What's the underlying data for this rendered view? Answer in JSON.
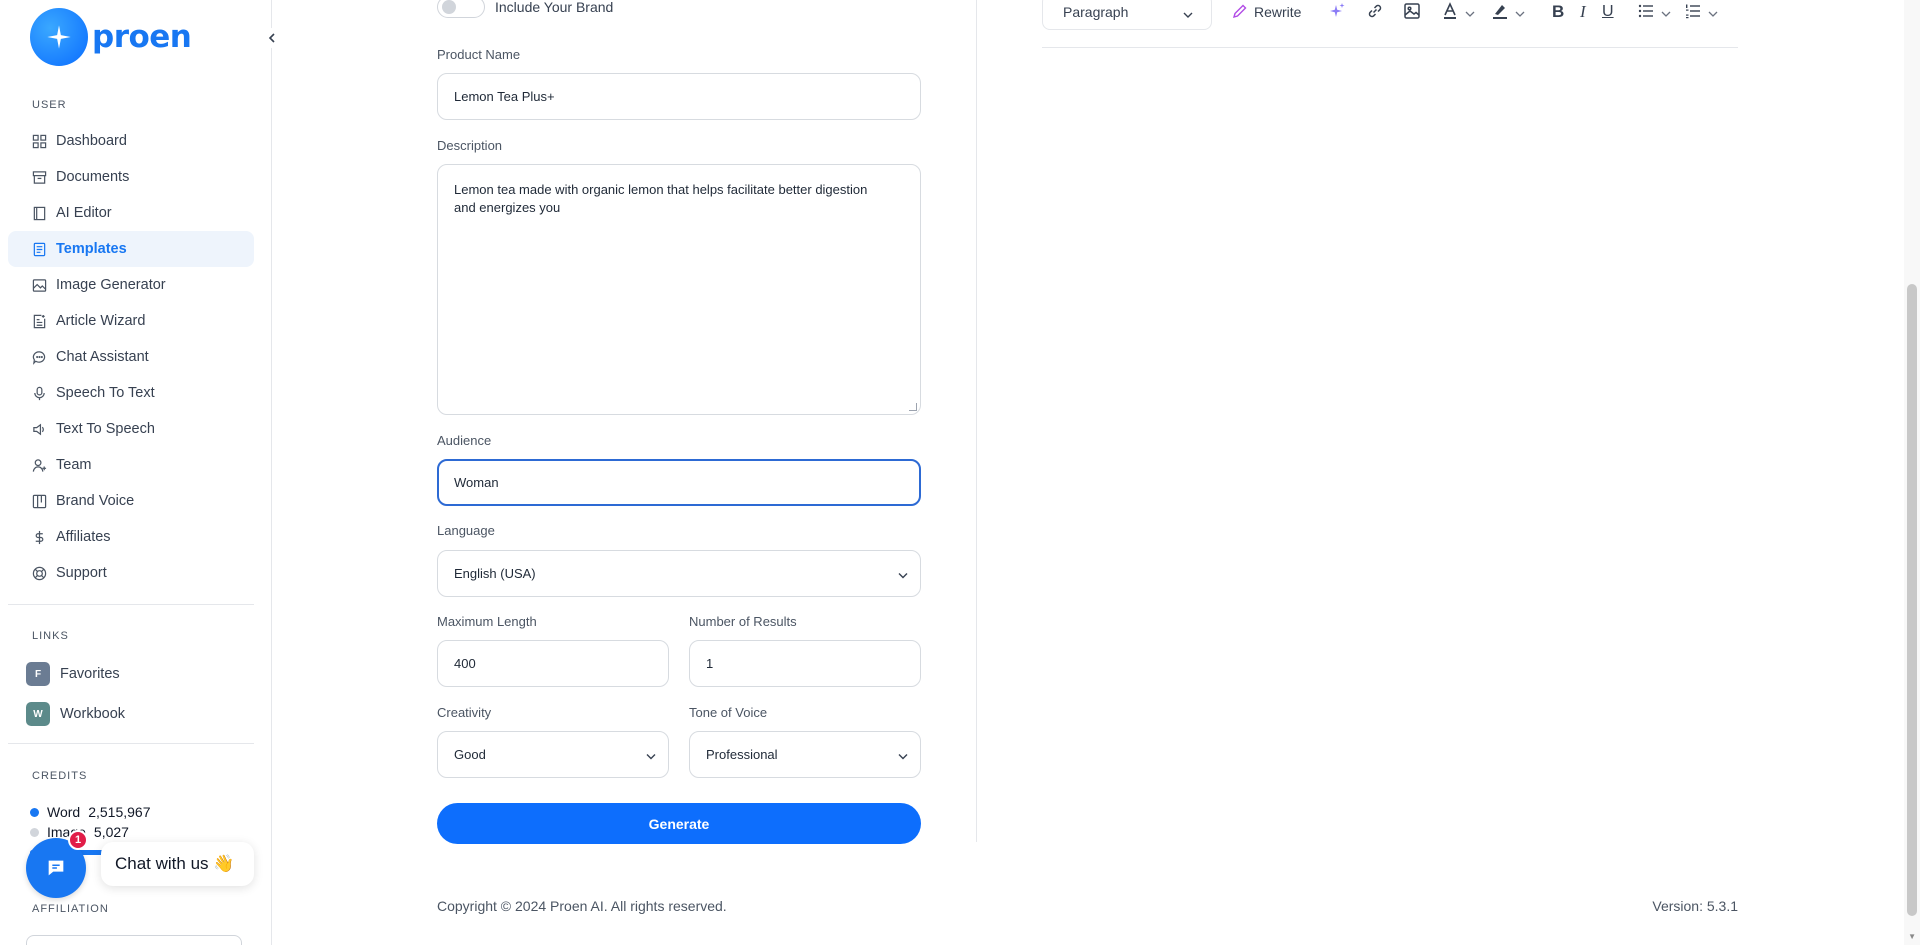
{
  "app": {
    "brand": "proen"
  },
  "sidebar": {
    "user_section": "USER",
    "items": [
      {
        "label": "Dashboard",
        "icon": "grid-icon"
      },
      {
        "label": "Documents",
        "icon": "archive-icon"
      },
      {
        "label": "AI Editor",
        "icon": "book-icon"
      },
      {
        "label": "Templates",
        "icon": "file-text-icon",
        "active": true
      },
      {
        "label": "Image Generator",
        "icon": "image-icon"
      },
      {
        "label": "Article Wizard",
        "icon": "article-icon"
      },
      {
        "label": "Chat Assistant",
        "icon": "message-circle-icon"
      },
      {
        "label": "Speech To Text",
        "icon": "microphone-icon"
      },
      {
        "label": "Text To Speech",
        "icon": "speaker-icon"
      },
      {
        "label": "Team",
        "icon": "user-plus-icon"
      },
      {
        "label": "Brand Voice",
        "icon": "layout-icon"
      },
      {
        "label": "Affiliates",
        "icon": "dollar-icon"
      },
      {
        "label": "Support",
        "icon": "lifebuoy-icon"
      }
    ],
    "links_section": "LINKS",
    "links": [
      {
        "badge": "F",
        "label": "Favorites",
        "color": "#6b7c93"
      },
      {
        "badge": "W",
        "label": "Workbook",
        "color": "#5c8a8a"
      }
    ],
    "credits_section": "CREDITS",
    "credits": [
      {
        "label": "Word",
        "value": "2,515,967",
        "color": "#1877f2"
      },
      {
        "label": "Image",
        "value": "5,027",
        "color": "#d1d5db"
      }
    ],
    "affiliation_section": "AFFILIATION"
  },
  "chat_widget": {
    "badge": "1",
    "bubble_text": "Chat with us 👋"
  },
  "form": {
    "brand_toggle_label": "Include Your Brand",
    "product_name_label": "Product Name",
    "product_name_value": "Lemon Tea Plus+",
    "description_label": "Description",
    "description_value": "Lemon tea made with organic lemon that helps facilitate better digestion and energizes you",
    "audience_label": "Audience",
    "audience_value": "Woman",
    "language_label": "Language",
    "language_value": "English (USA)",
    "max_length_label": "Maximum Length",
    "max_length_value": "400",
    "num_results_label": "Number of Results",
    "num_results_value": "1",
    "creativity_label": "Creativity",
    "creativity_value": "Good",
    "tone_label": "Tone of Voice",
    "tone_value": "Professional",
    "generate_label": "Generate"
  },
  "editor": {
    "paragraph_select": "Paragraph",
    "rewrite_label": "Rewrite"
  },
  "footer": {
    "copyright": "Copyright © 2024 Proen AI. All rights reserved.",
    "version": "Version: 5.3.1"
  },
  "colors": {
    "accent": "#1877f2",
    "primary_button": "#0d6efd",
    "focus_border": "#2d6ad4"
  }
}
